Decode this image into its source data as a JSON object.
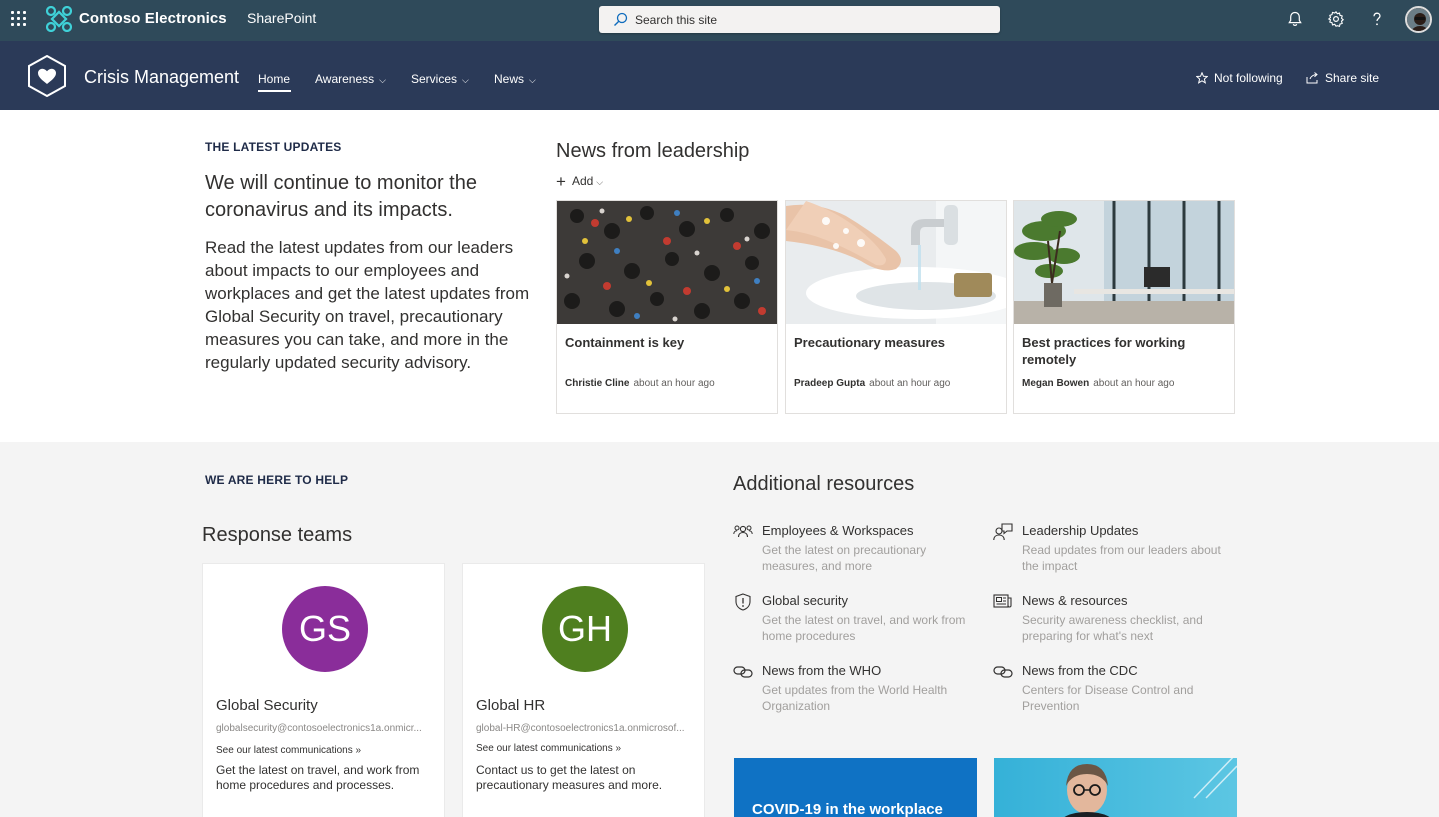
{
  "suite_bar": {
    "brand": "Contoso Electronics",
    "app": "SharePoint",
    "search_placeholder": "Search this site",
    "icons": [
      "waffle-icon",
      "bell-icon",
      "gear-icon",
      "help-icon"
    ]
  },
  "site_header": {
    "title": "Crisis Management",
    "nav": [
      {
        "label": "Home",
        "selected": true
      },
      {
        "label": "Awareness",
        "dropdown": true
      },
      {
        "label": "Services",
        "dropdown": true
      },
      {
        "label": "News",
        "dropdown": true
      }
    ],
    "follow_label": "Not following",
    "share_label": "Share site"
  },
  "latest": {
    "eyebrow": "THE LATEST UPDATES",
    "heading": "We will continue to monitor the coronavirus and its impacts.",
    "body": "Read the latest updates from our leaders about impacts to our employees and workplaces and get the latest updates from Global Security on travel, precautionary measures you can take, and more in the regularly updated security advisory."
  },
  "news": {
    "title": "News from leadership",
    "add_label": "Add",
    "items": [
      {
        "title": "Containment is key",
        "author": "Christie Cline",
        "time": "about an hour ago"
      },
      {
        "title": "Precautionary measures",
        "author": "Pradeep Gupta",
        "time": "about an hour ago"
      },
      {
        "title": "Best practices for working remotely",
        "author": "Megan Bowen",
        "time": "about an hour ago"
      }
    ]
  },
  "help": {
    "eyebrow": "WE ARE HERE TO HELP",
    "title": "Response teams",
    "teams": [
      {
        "initials": "GS",
        "name": "Global Security",
        "email": "globalsecurity@contosoelectronics1a.onmicr...",
        "link": "See our latest communications »",
        "desc": "Get the latest on travel, and work from home procedures and processes.",
        "color": "#8a2d9a"
      },
      {
        "initials": "GH",
        "name": "Global HR",
        "email": "global-HR@contosoelectronics1a.onmicrosof...",
        "link": "See our latest communications »",
        "desc": "Contact us to get the latest on precautionary measures and more.",
        "color": "#4f7f1f"
      }
    ]
  },
  "resources": {
    "title": "Additional resources",
    "items": [
      {
        "title": "Employees & Workspaces",
        "desc": "Get the latest on precautionary measures, and more",
        "icon": "people-icon"
      },
      {
        "title": "Leadership Updates",
        "desc": "Read updates from our leaders about the impact",
        "icon": "person-feedback-icon"
      },
      {
        "title": "Global security",
        "desc": "Get the latest on travel, and work from home procedures",
        "icon": "shield-alert-icon"
      },
      {
        "title": "News & resources",
        "desc": "Security awareness checklist, and preparing for what's next",
        "icon": "news-icon"
      },
      {
        "title": "News from the WHO",
        "desc": "Get updates from the World Health Organization",
        "icon": "link-icon"
      },
      {
        "title": "News from the CDC",
        "desc": "Centers for Disease Control and Prevention",
        "icon": "link-icon"
      }
    ]
  },
  "tiles": [
    {
      "text": "COVID-19 in the workplace"
    }
  ]
}
